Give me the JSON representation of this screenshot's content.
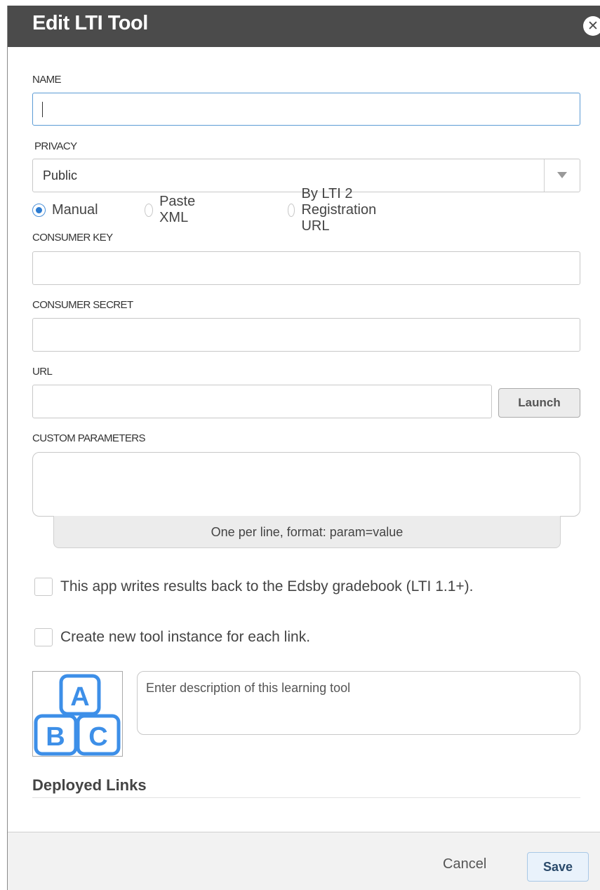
{
  "dialog": {
    "title": "Edit LTI Tool",
    "close_icon": "close-icon"
  },
  "form": {
    "name": {
      "label": "NAME",
      "value": ""
    },
    "privacy": {
      "label": "PRIVACY",
      "selected": "Public"
    },
    "mode_options": [
      {
        "label": "Manual",
        "checked": true
      },
      {
        "label": "Paste XML",
        "checked": false
      },
      {
        "label": "By LTI 2 Registration URL",
        "checked": false
      }
    ],
    "consumer_key": {
      "label": "CONSUMER KEY",
      "value": ""
    },
    "consumer_secret": {
      "label": "CONSUMER SECRET",
      "value": ""
    },
    "url": {
      "label": "URL",
      "value": "",
      "launch_label": "Launch"
    },
    "custom_parameters": {
      "label": "CUSTOM PARAMETERS",
      "value": "",
      "hint": "One per line, format: param=value"
    },
    "checkboxes": [
      {
        "label": "This app writes results back to the Edsby gradebook (LTI 1.1+).",
        "checked": false
      },
      {
        "label": "Create new tool instance for each link.",
        "checked": false
      }
    ],
    "tool_icon": {
      "icon": "abc-blocks-icon",
      "letters": [
        "A",
        "B",
        "C"
      ],
      "color": "#3d8fe8"
    },
    "description": {
      "placeholder": "Enter description of this learning tool",
      "value": ""
    }
  },
  "deployed_links": {
    "heading": "Deployed Links"
  },
  "footer": {
    "cancel_label": "Cancel",
    "save_label": "Save"
  },
  "colors": {
    "titlebar": "#4b4b4b",
    "accent": "#2b7bd1",
    "focus_border": "#5b9bd5"
  }
}
